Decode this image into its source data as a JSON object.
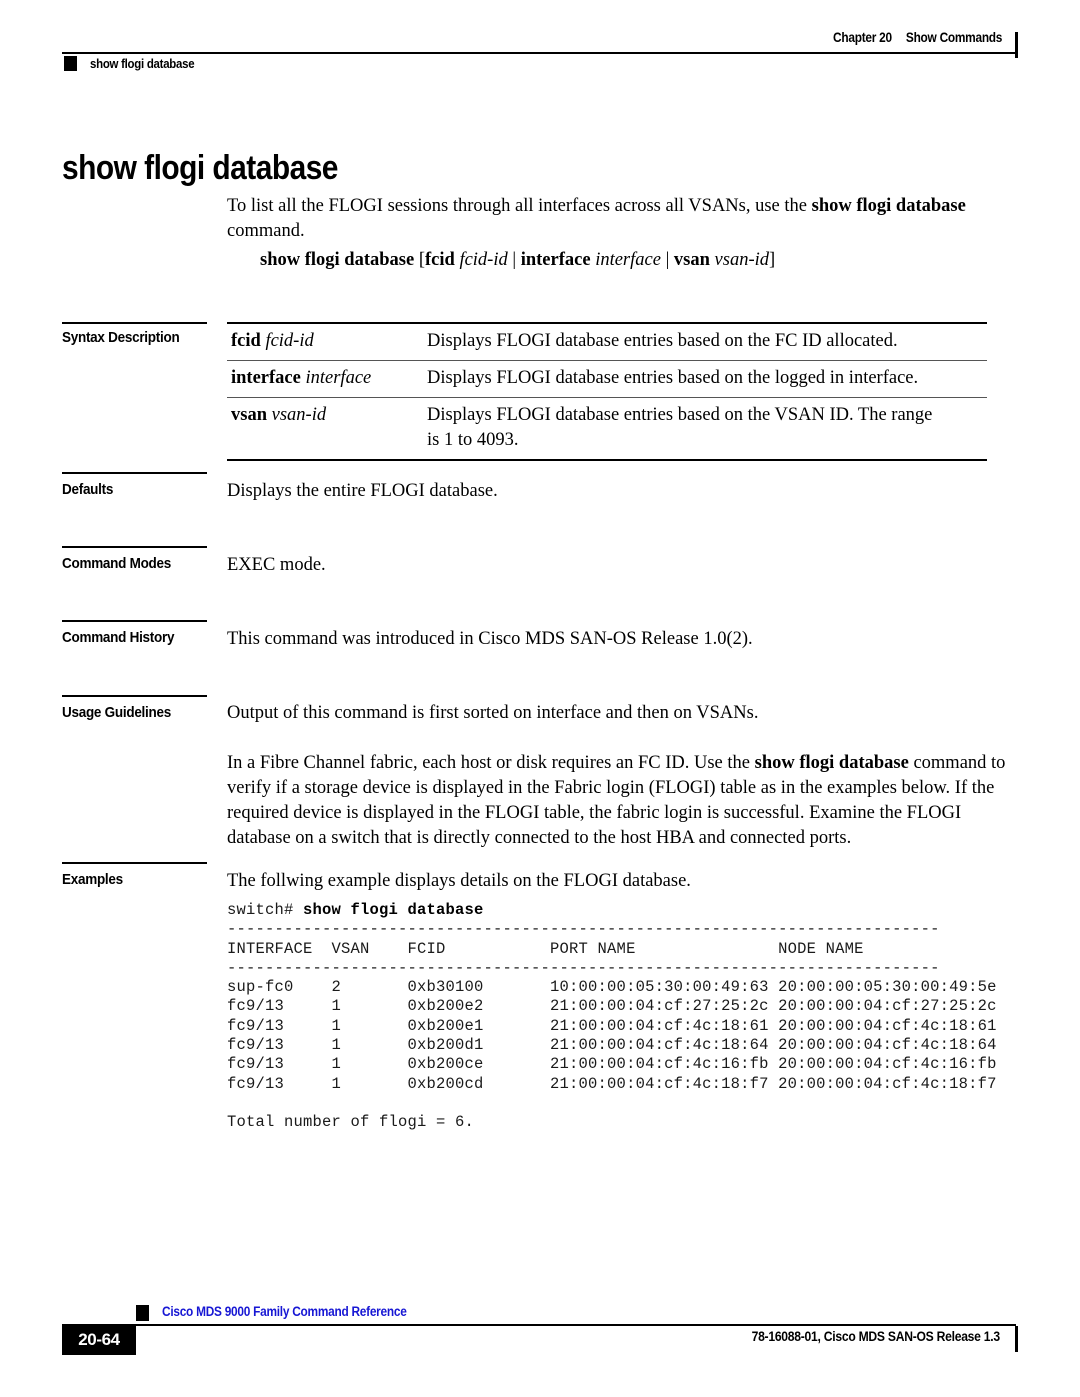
{
  "header": {
    "chapter": "Chapter 20",
    "chapter_title": "Show Commands",
    "running_head": "show flogi database"
  },
  "title": "show flogi database",
  "intro": {
    "text_before": "To list all the FLOGI sessions through all interfaces across all VSANs, use the ",
    "bold_command": "show flogi database",
    "text_after": " command."
  },
  "synopsis": {
    "command": "show flogi database",
    "open_bracket": " [",
    "kw_fcid": "fcid",
    "arg_fcid": " fcid-id",
    "sep1": " | ",
    "kw_interface": "interface",
    "arg_interface": " interface",
    "sep2": " | ",
    "kw_vsan": "vsan",
    "arg_vsan": " vsan-id",
    "close_bracket": "]"
  },
  "sections": {
    "syntax_description": {
      "label": "Syntax Description",
      "rows": [
        {
          "key_bold": "fcid",
          "key_italic": " fcid-id",
          "description": "Displays FLOGI database entries based on the FC ID allocated."
        },
        {
          "key_bold": "interface",
          "key_italic": " interface",
          "description": "Displays FLOGI database entries based on the logged in interface."
        },
        {
          "key_bold": "vsan",
          "key_italic": " vsan-id",
          "description": "Displays FLOGI database entries based on the VSAN ID. The range is 1 to 4093."
        }
      ]
    },
    "defaults": {
      "label": "Defaults",
      "text": "Displays the entire FLOGI database."
    },
    "command_modes": {
      "label": "Command Modes",
      "text": "EXEC mode."
    },
    "command_history": {
      "label": "Command History",
      "text": "This command was introduced in Cisco MDS SAN-OS Release 1.0(2)."
    },
    "usage_guidelines": {
      "label": "Usage Guidelines",
      "paragraph1": "Output of this command is first sorted on interface and then on VSANs.",
      "paragraph2_part1": "In a Fibre Channel fabric, each host or disk requires an FC ID. Use the ",
      "paragraph2_bold": "show flogi database",
      "paragraph2_part2": " command to verify if a storage device is displayed in the Fabric login (FLOGI) table as in the examples below. If the required device is displayed in the FLOGI table, the fabric login is successful. Examine the FLOGI database on a switch that is directly connected to the host HBA and connected ports."
    },
    "examples": {
      "label": "Examples",
      "text": "The follwing example displays details on the FLOGI database.",
      "console": {
        "prompt": "switch# ",
        "command": "show flogi database",
        "separator": "---------------------------------------------------------------------------",
        "columns": [
          "INTERFACE",
          "VSAN",
          "FCID",
          "PORT NAME",
          "NODE NAME"
        ],
        "header_line": "INTERFACE  VSAN    FCID           PORT NAME               NODE NAME",
        "rows": [
          {
            "interface": "sup-fc0",
            "vsan": "2",
            "fcid": "0xb30100",
            "port_name": "10:00:00:05:30:00:49:63",
            "node_name": "20:00:00:05:30:00:49:5e"
          },
          {
            "interface": "fc9/13",
            "vsan": "1",
            "fcid": "0xb200e2",
            "port_name": "21:00:00:04:cf:27:25:2c",
            "node_name": "20:00:00:04:cf:27:25:2c"
          },
          {
            "interface": "fc9/13",
            "vsan": "1",
            "fcid": "0xb200e1",
            "port_name": "21:00:00:04:cf:4c:18:61",
            "node_name": "20:00:00:04:cf:4c:18:61"
          },
          {
            "interface": "fc9/13",
            "vsan": "1",
            "fcid": "0xb200d1",
            "port_name": "21:00:00:04:cf:4c:18:64",
            "node_name": "20:00:00:04:cf:4c:18:64"
          },
          {
            "interface": "fc9/13",
            "vsan": "1",
            "fcid": "0xb200ce",
            "port_name": "21:00:00:04:cf:4c:16:fb",
            "node_name": "20:00:00:04:cf:4c:16:fb"
          },
          {
            "interface": "fc9/13",
            "vsan": "1",
            "fcid": "0xb200cd",
            "port_name": "21:00:00:04:cf:4c:18:f7",
            "node_name": "20:00:00:04:cf:4c:18:f7"
          }
        ],
        "total_line": "Total number of flogi = 6."
      }
    }
  },
  "footer": {
    "book_title": "Cisco MDS 9000 Family Command Reference",
    "page_number": "20-64",
    "doc_id": "78-16088-01, Cisco MDS SAN-OS Release 1.3",
    "link_color": "#1717d4"
  }
}
